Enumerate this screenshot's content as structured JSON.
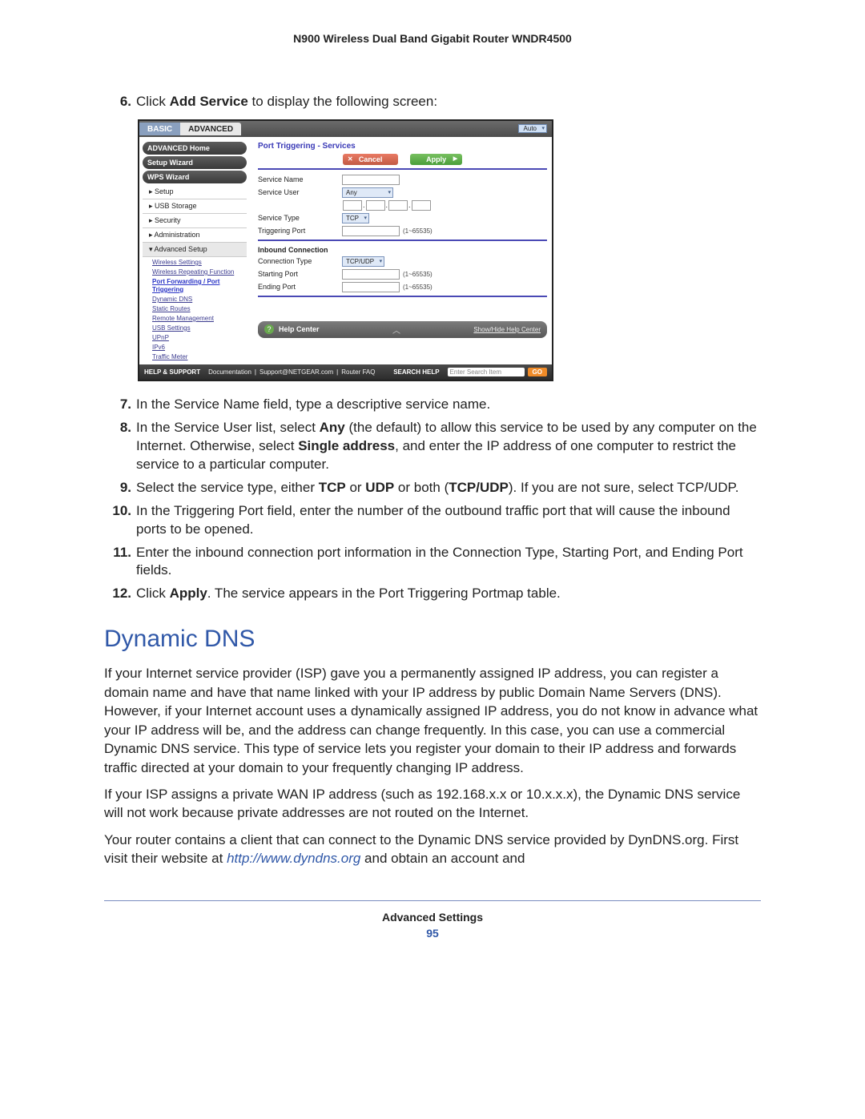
{
  "doc_header": "N900 Wireless Dual Band Gigabit Router WNDR4500",
  "steps_above": {
    "6": {
      "pre": "Click ",
      "bold": "Add Service",
      "post": " to display the following screen:"
    }
  },
  "screenshot": {
    "tabs": {
      "basic": "BASIC",
      "advanced": "ADVANCED",
      "auto": "Auto"
    },
    "sidebar": {
      "buttons": [
        "ADVANCED Home",
        "Setup Wizard",
        "WPS Wizard"
      ],
      "items": [
        "Setup",
        "USB Storage",
        "Security",
        "Administration",
        "Advanced Setup"
      ],
      "subs": [
        "Wireless Settings",
        "Wireless Repeating Function",
        "Port Forwarding / Port Triggering",
        "Dynamic DNS",
        "Static Routes",
        "Remote Management",
        "USB Settings",
        "UPnP",
        "IPv6",
        "Traffic Meter"
      ]
    },
    "main": {
      "title": "Port Triggering - Services",
      "cancel": "Cancel",
      "apply": "Apply",
      "labels": {
        "service_name": "Service Name",
        "service_user": "Service User",
        "service_type": "Service Type",
        "triggering_port": "Triggering Port",
        "inbound": "Inbound Connection",
        "connection_type": "Connection Type",
        "starting_port": "Starting Port",
        "ending_port": "Ending Port"
      },
      "selects": {
        "any": "Any",
        "tcp": "TCP",
        "tcpudp": "TCP/UDP"
      },
      "range": "(1~65535)"
    },
    "helpbar": {
      "q": "?",
      "label": "Help Center",
      "toggle": "Show/Hide Help Center"
    },
    "footer": {
      "help_support": "HELP & SUPPORT",
      "links": [
        "Documentation",
        "Support@NETGEAR.com",
        "Router FAQ"
      ],
      "search_label": "SEARCH HELP",
      "search_placeholder": "Enter Search Item",
      "go": "GO"
    }
  },
  "steps_below": [
    {
      "n": "7.",
      "html": "In the Service Name field, type a descriptive service name."
    },
    {
      "n": "8.",
      "html": "In the Service User list, select <b>Any</b> (the default) to allow this service to be used by any computer on the Internet. Otherwise, select <b>Single address</b>, and enter the IP address of one computer to restrict the service to a particular computer."
    },
    {
      "n": "9.",
      "html": "Select the service type, either <b>TCP</b> or <b>UDP</b> or both (<b>TCP/UDP</b>). If you are not sure, select TCP/UDP."
    },
    {
      "n": "10.",
      "html": "In the Triggering Port field, enter the number of the outbound traffic port that will cause the inbound ports to be opened."
    },
    {
      "n": "11.",
      "html": "Enter the inbound connection port information in the Connection Type, Starting Port, and Ending Port fields."
    },
    {
      "n": "12.",
      "html": "Click <b>Apply</b>. The service appears in the Port Triggering Portmap table."
    }
  ],
  "section_title": "Dynamic DNS",
  "paras": [
    "If your Internet service provider (ISP) gave you a permanently assigned IP address, you can register a domain name and have that name linked with your IP address by public Domain Name Servers (DNS). However, if your Internet account uses a dynamically assigned IP address, you do not know in advance what your IP address will be, and the address can change frequently. In this case, you can use a commercial Dynamic DNS service. This type of service lets you register your domain to their IP address and forwards traffic directed at your domain to your frequently changing IP address.",
    "If your ISP assigns a private WAN IP address (such as 192.168.x.x or 10.x.x.x), the Dynamic DNS service will not work because private addresses are not routed on the Internet."
  ],
  "para3_pre": "Your router contains a client that can connect to the Dynamic DNS service provided by DynDNS.org. First visit their website at ",
  "para3_link": "http://www.dyndns.org",
  "para3_post": " and obtain an account and",
  "footer_label": "Advanced Settings",
  "page_number": "95"
}
